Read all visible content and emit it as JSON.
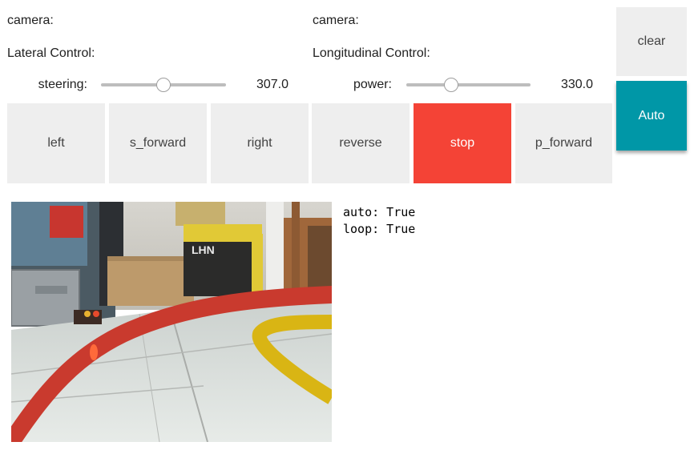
{
  "left_panel": {
    "camera_label": "camera:",
    "control_label": "Lateral Control:",
    "slider_label": "steering:",
    "slider_value": "307.0",
    "slider_fraction": 0.5
  },
  "right_panel": {
    "camera_label": "camera:",
    "control_label": "Longitudinal Control:",
    "slider_label": "power:",
    "slider_value": "330.0",
    "slider_fraction": 0.34
  },
  "buttons": {
    "left": "left",
    "s_forward": "s_forward",
    "right": "right",
    "reverse": "reverse",
    "stop": "stop",
    "p_forward": "p_forward",
    "clear": "clear",
    "auto": "Auto"
  },
  "status": {
    "auto": "auto: True",
    "loop": "loop: True"
  },
  "colors": {
    "stop": "#f44336",
    "auto": "#0097a7",
    "button_bg": "#eeeeee"
  }
}
